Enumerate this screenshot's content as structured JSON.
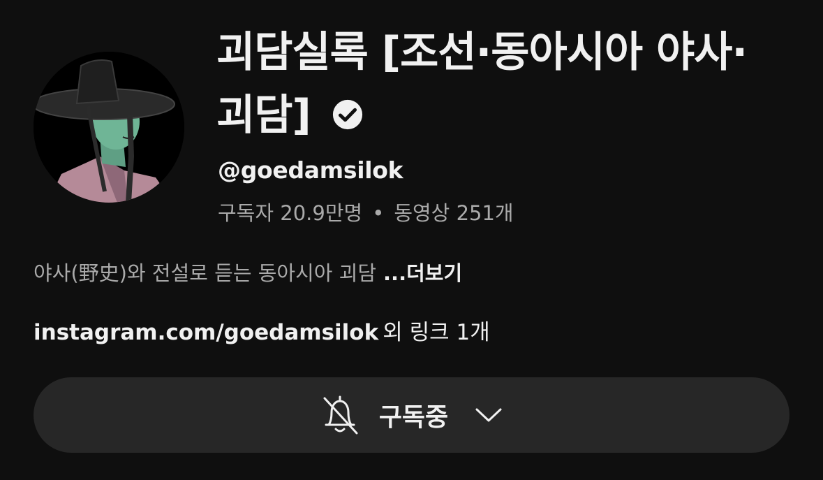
{
  "channel": {
    "title": "괴담실록 [조선·동아시아 야사·괴담]",
    "handle": "@goedamsilok",
    "subscribers": "구독자 20.9만명",
    "stats_separator": "•",
    "videos": "동영상 251개",
    "description": "야사(野史)와 전설로 듣는 동아시아 괴담",
    "more_label": "...더보기",
    "link_primary": "instagram.com/goedamsilok",
    "link_extra": "외 링크 1개"
  },
  "subscribe_button": {
    "label": "구독중",
    "icon": "bell-off-icon",
    "dropdown_icon": "chevron-down-icon"
  },
  "icons": {
    "verified": "verified-badge-icon",
    "avatar": "avatar"
  },
  "colors": {
    "background": "#0f0f0f",
    "text_primary": "#f1f1f1",
    "text_secondary": "#aaaaaa",
    "button_bg": "#272727"
  }
}
